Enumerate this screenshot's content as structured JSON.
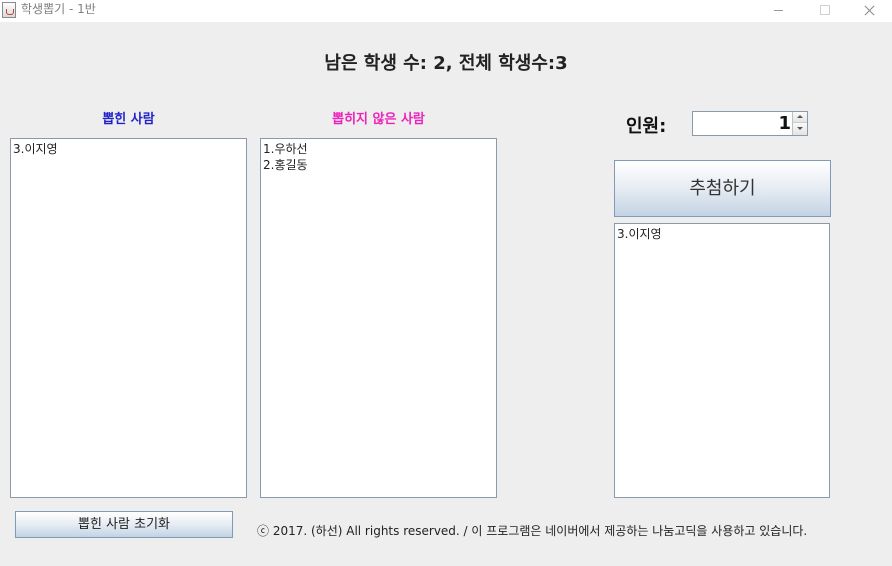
{
  "window": {
    "title": "학생뽑기 - 1반"
  },
  "status": {
    "text": "남은 학생 수: 2, 전체 학생수:3"
  },
  "drawn_panel": {
    "label": "뽑힌 사람",
    "label_color": "#2222cc",
    "items": [
      "3.이지영"
    ]
  },
  "not_drawn_panel": {
    "label": "뽑히지 않은 사람",
    "label_color": "#ee22bb",
    "items": [
      "1.우하선",
      "2.홍길동"
    ]
  },
  "count": {
    "label": "인원:",
    "value": "1"
  },
  "draw_button": {
    "label": "추첨하기"
  },
  "result_panel": {
    "items": [
      "3.이지영"
    ]
  },
  "reset_button": {
    "label": "뽑힌 사람 초기화"
  },
  "footer": {
    "text": "ⓒ 2017. (하선) All rights reserved. / 이 프로그램은 네이버에서 제공하는 나눔고딕을 사용하고 있습니다."
  }
}
